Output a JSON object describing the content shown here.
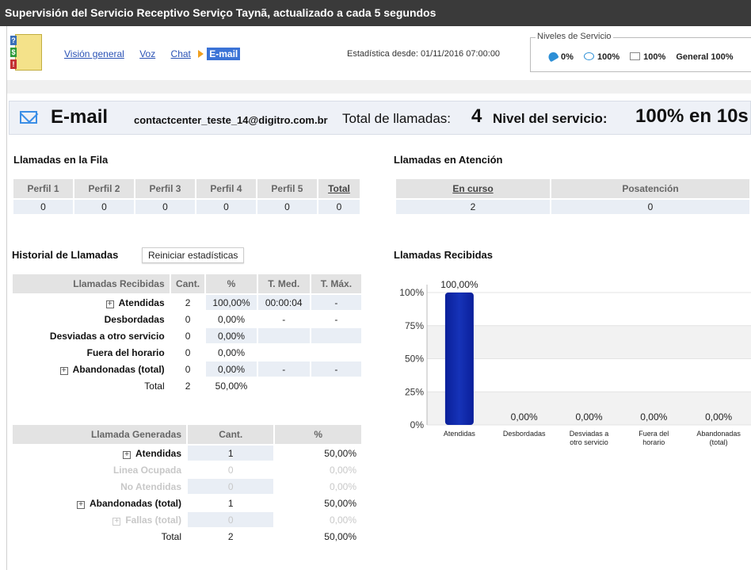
{
  "title": "Supervisión del Servicio Receptivo Serviço Taynã, actualizado a cada 5 segundos",
  "nav": {
    "links": [
      "Visión general",
      "Voz",
      "Chat"
    ],
    "active": "E-mail",
    "stats_since": "Estadística desde: 01/11/2016 07:00:00"
  },
  "service_levels": {
    "legend": "Niveles de Servicio",
    "voice": "0%",
    "chat": "100%",
    "email": "100%",
    "general": "General 100%"
  },
  "header": {
    "title": "E-mail",
    "address": "contactcenter_teste_14@digitro.com.br",
    "total_label": "Total de llamadas:",
    "total_value": "4",
    "ns_label": "Nivel del servicio:",
    "ns_value": "100% en 10s"
  },
  "queue": {
    "title": "Llamadas en la Fila",
    "headers": [
      "Perfil 1",
      "Perfil 2",
      "Perfil 3",
      "Perfil 4",
      "Perfil 5",
      "Total"
    ],
    "values": [
      "0",
      "0",
      "0",
      "0",
      "0",
      "0"
    ]
  },
  "attention": {
    "title": "Llamadas en Atención",
    "headers": [
      "En curso",
      "Posatención"
    ],
    "values": [
      "2",
      "0"
    ]
  },
  "history": {
    "title": "Historial de Llamadas",
    "reset_label": "Reiniciar estadísticas",
    "received": {
      "headers": [
        "Llamadas Recibidas",
        "Cant.",
        "%",
        "T. Med.",
        "T. Máx."
      ],
      "rows": [
        {
          "label": "Atendidas",
          "expand": true,
          "cant": "2",
          "pct": "100,00%",
          "med": "00:00:04",
          "max": "-"
        },
        {
          "label": "Desbordadas",
          "expand": false,
          "cant": "0",
          "pct": "0,00%",
          "med": "-",
          "max": "-"
        },
        {
          "label": "Desviadas a otro servicio",
          "expand": false,
          "cant": "0",
          "pct": "0,00%",
          "med": "",
          "max": ""
        },
        {
          "label": "Fuera del horario",
          "expand": false,
          "cant": "0",
          "pct": "0,00%",
          "med": "",
          "max": ""
        },
        {
          "label": "Abandonadas (total)",
          "expand": true,
          "cant": "0",
          "pct": "0,00%",
          "med": "-",
          "max": "-"
        }
      ],
      "total": {
        "label": "Total",
        "cant": "2",
        "pct": "50,00%"
      }
    },
    "generated": {
      "headers": [
        "Llamada Generadas",
        "Cant.",
        "%"
      ],
      "rows": [
        {
          "label": "Atendidas",
          "expand": true,
          "cant": "1",
          "pct": "50,00%",
          "muted": false
        },
        {
          "label": "Linea Ocupada",
          "expand": false,
          "cant": "0",
          "pct": "0,00%",
          "muted": true
        },
        {
          "label": "No Atendidas",
          "expand": false,
          "cant": "0",
          "pct": "0,00%",
          "muted": true
        },
        {
          "label": "Abandonadas (total)",
          "expand": true,
          "cant": "1",
          "pct": "50,00%",
          "muted": false
        },
        {
          "label": "Fallas (total)",
          "expand": true,
          "cant": "0",
          "pct": "0,00%",
          "muted": true
        }
      ],
      "total": {
        "label": "Total",
        "cant": "2",
        "pct": "50,00%"
      }
    }
  },
  "chart_title": "Llamadas Recibidas",
  "colors": {
    "accent": "#3b73d6",
    "bar": "#1633b8",
    "bar_top": "#0a1f9a"
  },
  "chart_data": {
    "type": "bar",
    "categories": [
      "Atendidas",
      "Desbordadas",
      "Desviadas a otro servicio",
      "Fuera del horario",
      "Abandonadas (total)"
    ],
    "category_lines": [
      [
        "Atendidas"
      ],
      [
        "Desbordadas"
      ],
      [
        "Desviadas a",
        "otro servicio"
      ],
      [
        "Fuera del",
        "horario"
      ],
      [
        "Abandonadas",
        "(total)"
      ]
    ],
    "values": [
      100,
      0,
      0,
      0,
      0
    ],
    "value_labels": [
      "100,00%",
      "0,00%",
      "0,00%",
      "0,00%",
      "0,00%"
    ],
    "yticks": [
      "0%",
      "25%",
      "50%",
      "75%",
      "100%"
    ],
    "ylim": [
      0,
      100
    ],
    "title": "",
    "xlabel": "",
    "ylabel": ""
  }
}
